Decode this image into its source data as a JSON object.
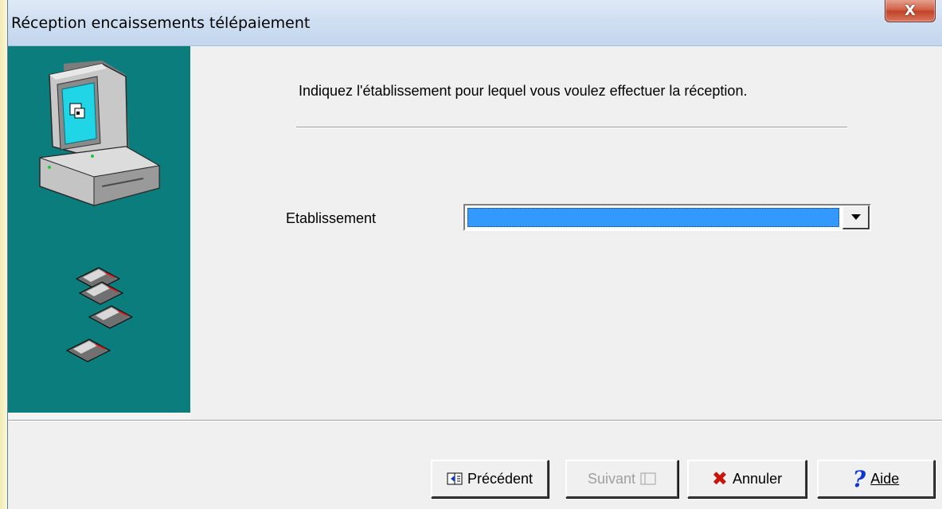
{
  "window": {
    "title": "Réception encaissements télépaiement",
    "close_symbol": "X"
  },
  "wizard": {
    "instruction": "Indiquez l'établissement pour lequel vous voulez effectuer la réception.",
    "field_label": "Etablissement",
    "field_value": "",
    "accent_color": "#3399ff",
    "side_panel_color": "#0b7d7c"
  },
  "buttons": {
    "previous": "Précédent",
    "next": "Suivant",
    "cancel": "Annuler",
    "help": "Aide"
  },
  "icons": {
    "computer": "computer-icon",
    "diskettes": "floppy-disks-icon",
    "previous": "arrow-left-box-icon",
    "next": "arrow-right-box-icon",
    "cancel": "red-x-icon",
    "help": "question-mark-icon"
  }
}
